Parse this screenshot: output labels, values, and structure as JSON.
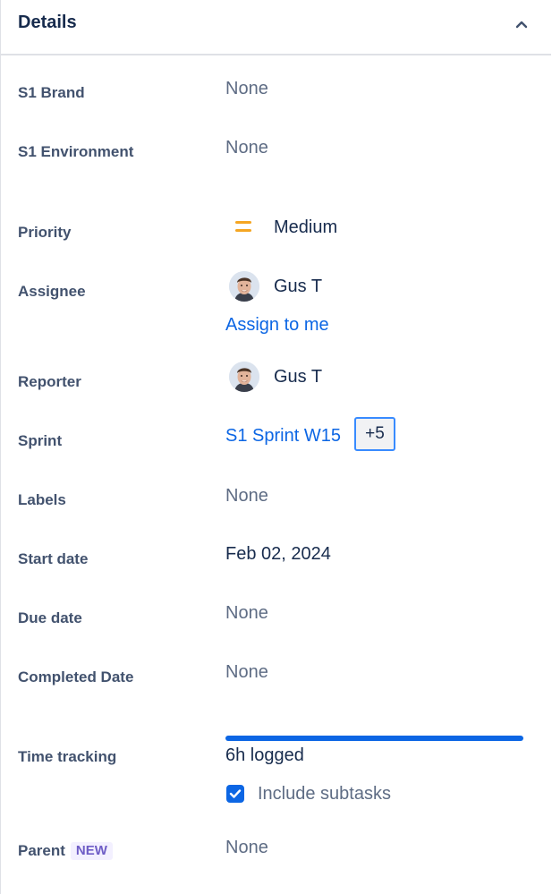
{
  "header": {
    "title": "Details"
  },
  "fields": {
    "s1_brand": {
      "label": "S1 Brand",
      "value": "None"
    },
    "s1_environment": {
      "label": "S1 Environment",
      "value": "None"
    },
    "priority": {
      "label": "Priority",
      "value": "Medium",
      "icon": "priority-medium-icon",
      "icon_color": "#f5a623"
    },
    "assignee": {
      "label": "Assignee",
      "name": "Gus T",
      "action": "Assign to me"
    },
    "reporter": {
      "label": "Reporter",
      "name": "Gus T"
    },
    "sprint": {
      "label": "Sprint",
      "value": "S1 Sprint W15",
      "more": "+5"
    },
    "labels": {
      "label": "Labels",
      "value": "None"
    },
    "start_date": {
      "label": "Start date",
      "value": "Feb 02, 2024"
    },
    "due_date": {
      "label": "Due date",
      "value": "None"
    },
    "completed_date": {
      "label": "Completed Date",
      "value": "None"
    },
    "time_tracking": {
      "label": "Time tracking",
      "logged": "6h logged",
      "progress": 1.0,
      "checkbox_label": "Include subtasks",
      "checked": true
    },
    "parent": {
      "label": "Parent",
      "badge": "NEW",
      "value": "None"
    }
  },
  "colors": {
    "accent": "#0c66e4",
    "label": "#42526e",
    "muted": "#5e6c84"
  }
}
